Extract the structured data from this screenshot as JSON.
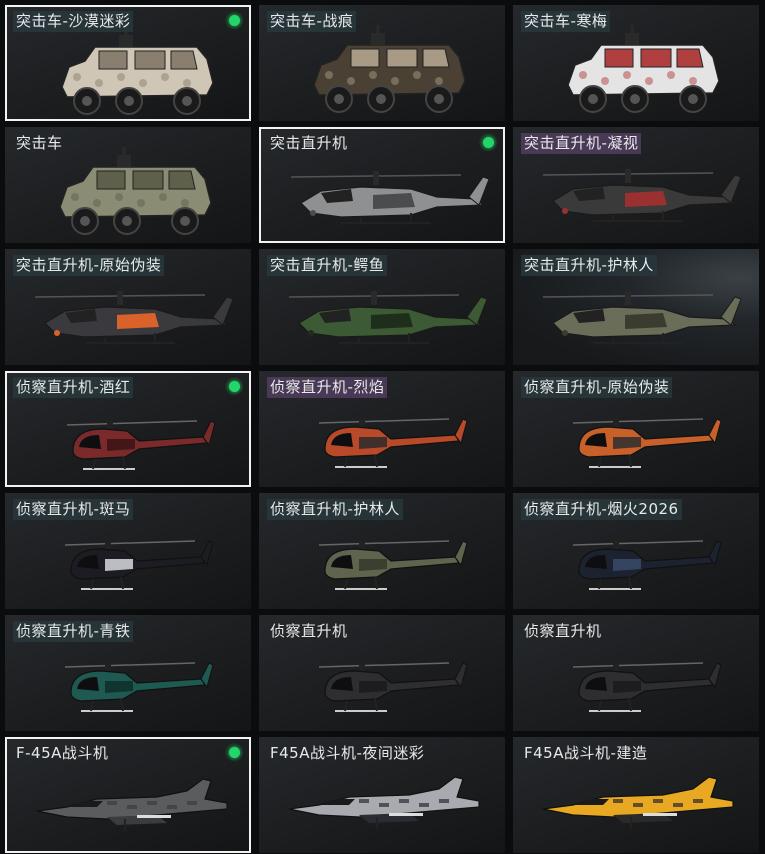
{
  "cards": [
    {
      "label": "突击车-沙漠迷彩",
      "kind": "vehicle",
      "primary": "#cfc6b6",
      "secondary": "#8a7f6e",
      "selected": true,
      "equipped": true,
      "tag": "dark"
    },
    {
      "label": "突击车-战痕",
      "kind": "vehicle",
      "primary": "#4a4034",
      "secondary": "#a89a84",
      "selected": false,
      "equipped": false,
      "tag": "dark"
    },
    {
      "label": "突击车-寒梅",
      "kind": "vehicle",
      "primary": "#e4e4e4",
      "secondary": "#b04040",
      "selected": false,
      "equipped": false,
      "tag": "dark"
    },
    {
      "label": "突击车",
      "kind": "vehicle",
      "primary": "#8a8c74",
      "secondary": "#5e604c",
      "selected": false,
      "equipped": false,
      "tag": "none"
    },
    {
      "label": "突击直升机",
      "kind": "attack-heli",
      "primary": "#8e9092",
      "secondary": "#4a4c4e",
      "selected": true,
      "equipped": true,
      "tag": "none"
    },
    {
      "label": "突击直升机-凝视",
      "kind": "attack-heli",
      "primary": "#3a3a3a",
      "secondary": "#9a3030",
      "selected": false,
      "equipped": false,
      "tag": "purple"
    },
    {
      "label": "突击直升机-原始伪装",
      "kind": "attack-heli",
      "primary": "#3a3a3e",
      "secondary": "#d8622a",
      "selected": false,
      "equipped": false,
      "tag": "dark"
    },
    {
      "label": "突击直升机-鳄鱼",
      "kind": "attack-heli",
      "primary": "#3c5a34",
      "secondary": "#1e2e1a",
      "selected": false,
      "equipped": false,
      "tag": "dark"
    },
    {
      "label": "突击直升机-护林人",
      "kind": "attack-heli",
      "primary": "#6a6e58",
      "secondary": "#3a3c30",
      "selected": false,
      "equipped": false,
      "tag": "dark",
      "lit": true
    },
    {
      "label": "侦察直升机-酒红",
      "kind": "scout-heli",
      "primary": "#7a2a2a",
      "secondary": "#3a1414",
      "selected": true,
      "equipped": true,
      "tag": "dark"
    },
    {
      "label": "侦察直升机-烈焰",
      "kind": "scout-heli",
      "primary": "#b84a2a",
      "secondary": "#2a2a2a",
      "selected": false,
      "equipped": false,
      "tag": "purple"
    },
    {
      "label": "侦察直升机-原始伪装",
      "kind": "scout-heli",
      "primary": "#c8602a",
      "secondary": "#2e2e30",
      "selected": false,
      "equipped": false,
      "tag": "dark"
    },
    {
      "label": "侦察直升机-斑马",
      "kind": "scout-heli",
      "primary": "#1c1c22",
      "secondary": "#d8d8e0",
      "selected": false,
      "equipped": false,
      "tag": "dark"
    },
    {
      "label": "侦察直升机-护林人",
      "kind": "scout-heli",
      "primary": "#5e644e",
      "secondary": "#34382c",
      "selected": false,
      "equipped": false,
      "tag": "dark"
    },
    {
      "label": "侦察直升机-烟火2026",
      "kind": "scout-heli",
      "primary": "#1c2230",
      "secondary": "#3a4a6a",
      "selected": false,
      "equipped": false,
      "tag": "dark"
    },
    {
      "label": "侦察直升机-青铁",
      "kind": "scout-heli",
      "primary": "#1e5a52",
      "secondary": "#0e2e2a",
      "selected": false,
      "equipped": false,
      "tag": "dark"
    },
    {
      "label": "侦察直升机",
      "kind": "scout-heli",
      "primary": "#2e2e30",
      "secondary": "#1a1a1c",
      "selected": false,
      "equipped": false,
      "tag": "none"
    },
    {
      "label": "侦察直升机",
      "kind": "scout-heli",
      "primary": "#2e2e30",
      "secondary": "#1a1a1c",
      "selected": false,
      "equipped": false,
      "tag": "none"
    },
    {
      "label": "F-45A战斗机",
      "kind": "jet",
      "primary": "#5a5c5e",
      "secondary": "#3a3c3e",
      "selected": true,
      "equipped": true,
      "tag": "none"
    },
    {
      "label": "F45A战斗机-夜间迷彩",
      "kind": "jet",
      "primary": "#a8aab0",
      "secondary": "#2a2c34",
      "selected": false,
      "equipped": false,
      "tag": "none"
    },
    {
      "label": "F45A战斗机-建造",
      "kind": "jet",
      "primary": "#e8a822",
      "secondary": "#2a2a2a",
      "selected": false,
      "equipped": false,
      "tag": "none"
    }
  ]
}
